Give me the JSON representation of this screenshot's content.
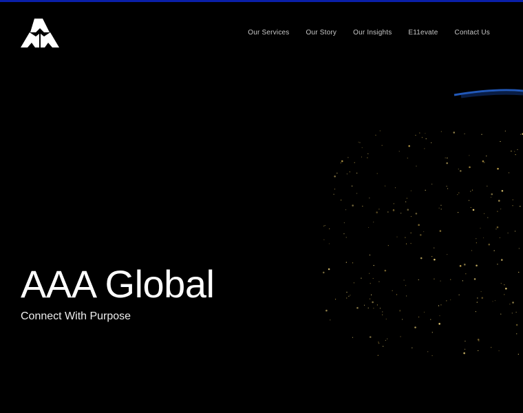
{
  "brand": {
    "name": "AAA Global logo",
    "accent": "#0a1fa8"
  },
  "nav": {
    "items": [
      {
        "label": "Our Services"
      },
      {
        "label": "Our Story"
      },
      {
        "label": "Our Insights"
      },
      {
        "label": "E11evate"
      },
      {
        "label": "Contact Us"
      }
    ]
  },
  "hero": {
    "title": "AAA Global",
    "subtitle": "Connect With Purpose"
  }
}
